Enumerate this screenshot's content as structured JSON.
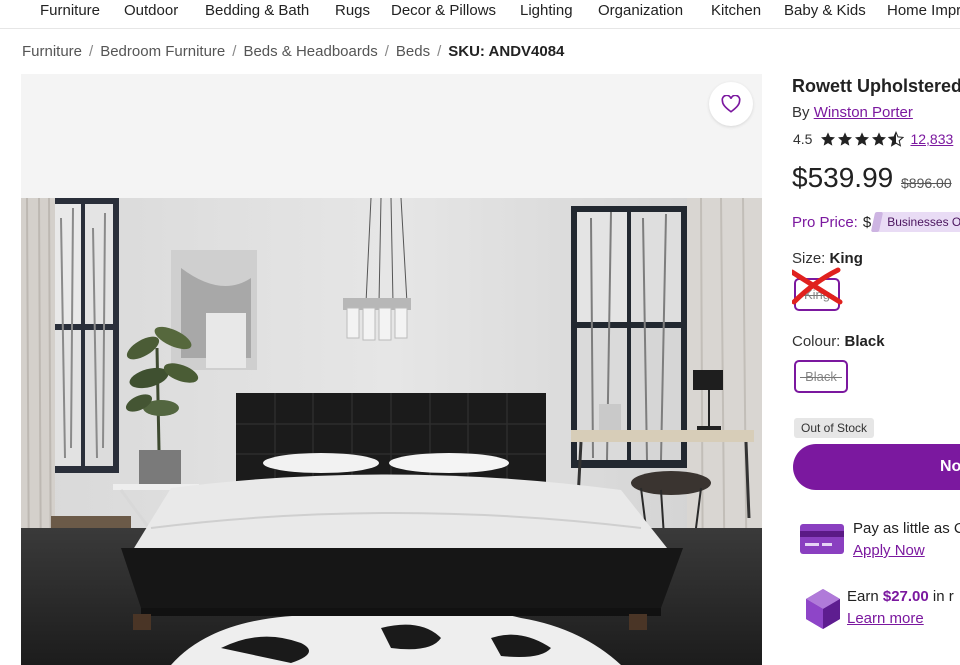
{
  "nav": {
    "items": [
      "Furniture",
      "Outdoor",
      "Bedding & Bath",
      "Rugs",
      "Decor & Pillows",
      "Lighting",
      "Organization",
      "Kitchen",
      "Baby & Kids",
      "Home Impr"
    ]
  },
  "breadcrumb": {
    "items": [
      "Furniture",
      "Bedroom Furniture",
      "Beds & Headboards",
      "Beds"
    ],
    "separator": "/",
    "sku": "SKU: ANDV4084"
  },
  "product": {
    "title": "Rowett Upholstered",
    "by_prefix": "By",
    "brand": "Winston Porter",
    "rating": "4.5",
    "stars_filled": 4.5,
    "review_count": "12,833",
    "price": "$539.99",
    "was_price": "$896.00",
    "pro_label": "Pro Price:",
    "pro_amount": "$",
    "business_tag": "Businesses On"
  },
  "options": {
    "size_label": "Size:",
    "size_value": "King",
    "size_swatch": "King",
    "colour_label": "Colour:",
    "colour_value": "Black",
    "colour_swatch": "Black"
  },
  "stock": {
    "badge": "Out of Stock",
    "button": "No"
  },
  "promos": {
    "pay_text": "Pay as little as C",
    "pay_link": "Apply Now",
    "earn_prefix": "Earn",
    "earn_amount": "$27.00",
    "earn_suffix": "in r",
    "earn_link": "Learn more"
  },
  "colors": {
    "accent": "#7b189f",
    "tag_bg": "#e9dcf5",
    "cross": "#e0211e"
  },
  "icons": {
    "favorite": "heart-icon",
    "star": "star-icon",
    "card": "credit-card-icon",
    "reward": "gem-icon"
  }
}
